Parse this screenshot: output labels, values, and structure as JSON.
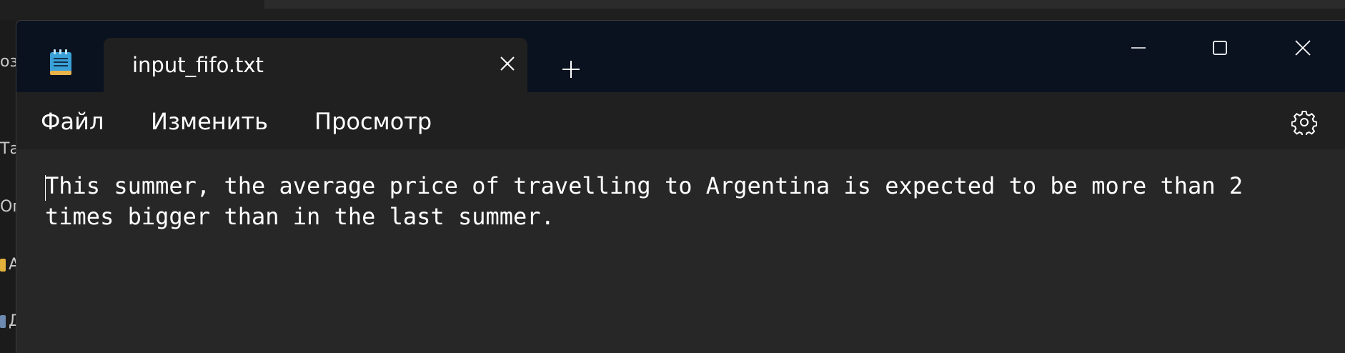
{
  "tab": {
    "title": "input_fifo.txt",
    "close_icon": "close-icon",
    "new_tab_icon": "plus-icon"
  },
  "app_icon": "notepad-icon",
  "window_controls": {
    "minimize_icon": "minimize-icon",
    "maximize_icon": "maximize-icon",
    "close_icon": "close-icon"
  },
  "menu": {
    "items": [
      "Файл",
      "Изменить",
      "Просмотр"
    ],
    "settings_icon": "gear-icon"
  },
  "editor": {
    "content": "This summer, the average price of travelling to Argentina is expected to be more than 2\ntimes bigger than in the last summer."
  },
  "background_fragments": [
    "оз",
    "Та",
    "Ог",
    "А",
    "Д"
  ],
  "colors": {
    "titlebar": "#0a1220",
    "tab": "#202020",
    "menubar": "#202020",
    "editor": "#272727",
    "text": "#ffffff"
  }
}
